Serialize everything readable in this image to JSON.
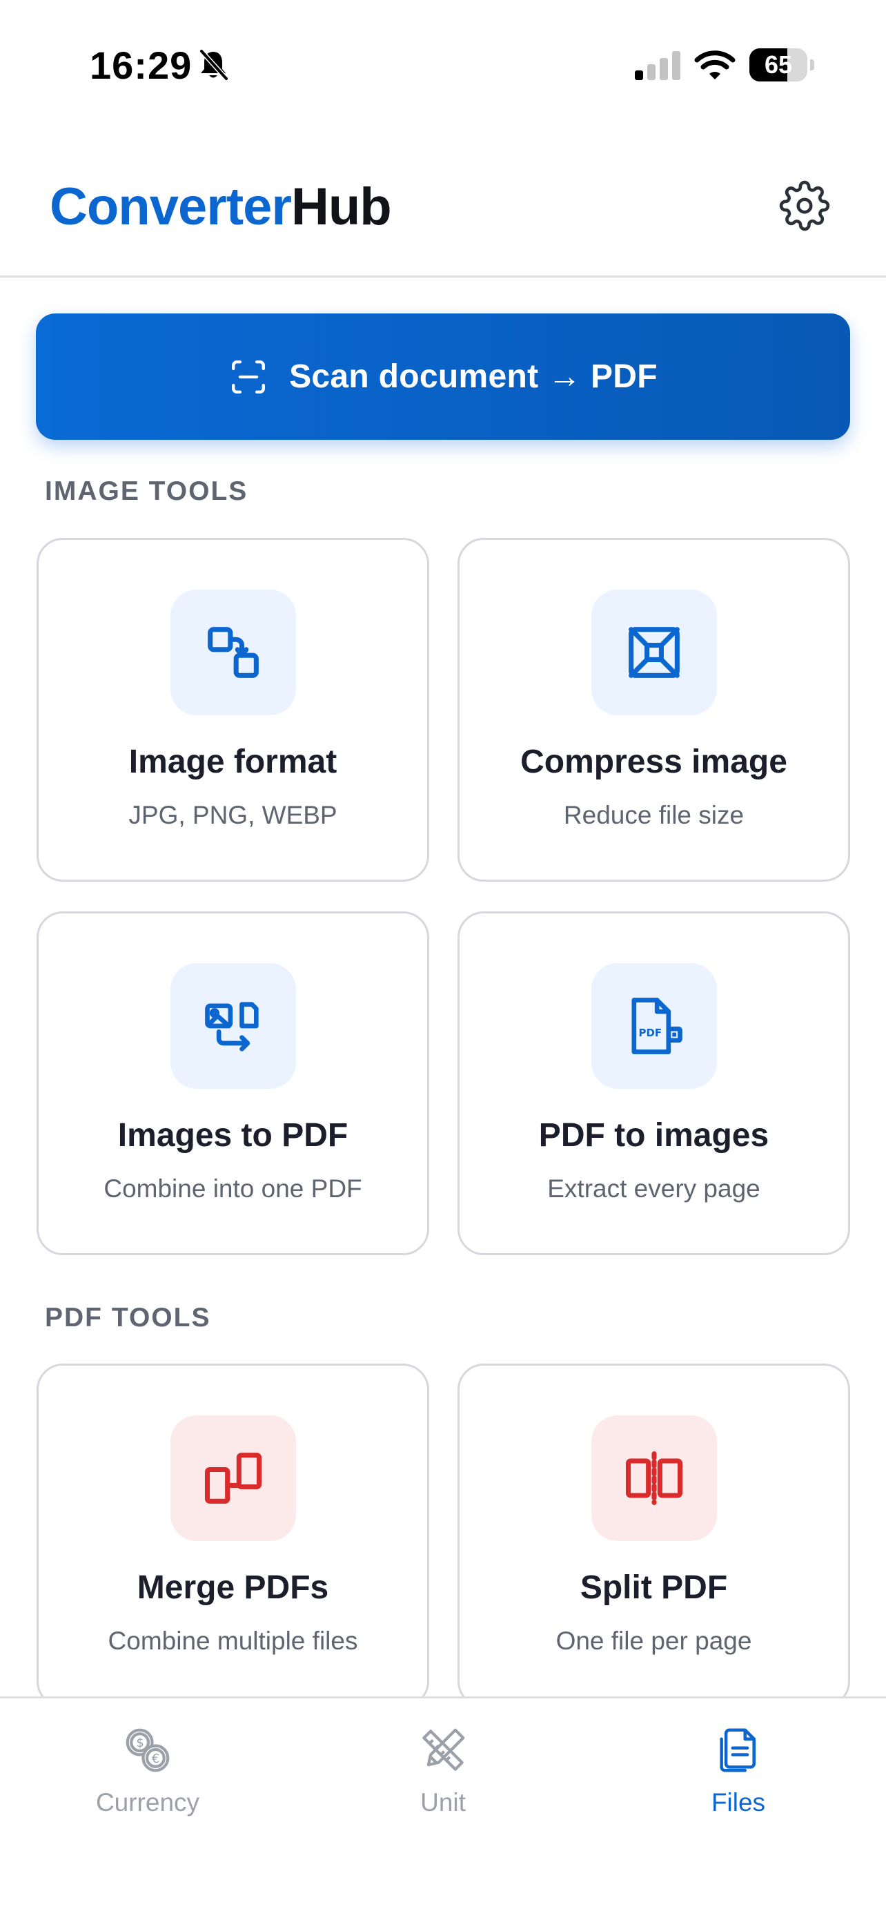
{
  "status_bar": {
    "time": "16:29",
    "battery": "65",
    "battery_level": 0.65,
    "icons": [
      "bell-slash-icon",
      "cellular-signal-icon",
      "wifi-icon",
      "battery-icon"
    ]
  },
  "header": {
    "logo_part_1": "Converter",
    "logo_part_2": "Hub",
    "settings_icon": "gear-icon"
  },
  "scan": {
    "label": "Scan document → PDF",
    "icon": "scan-frame-icon"
  },
  "sections": {
    "image_tools": "IMAGE TOOLS",
    "pdf_tools": "PDF TOOLS"
  },
  "image_tools": [
    {
      "title": "Image format",
      "subtitle": "JPG, PNG, WEBP",
      "icon": "format-convert-icon"
    },
    {
      "title": "Compress image",
      "subtitle": "Reduce file size",
      "icon": "compress-icon"
    },
    {
      "title": "Images to PDF",
      "subtitle": "Combine into one PDF",
      "icon": "images-to-pdf-icon"
    },
    {
      "title": "PDF to images",
      "subtitle": "Extract every page",
      "icon": "pdf-to-images-icon"
    }
  ],
  "pdf_tools": [
    {
      "title": "Merge PDFs",
      "subtitle": "Combine multiple files",
      "icon": "merge-icon"
    },
    {
      "title": "Split PDF",
      "subtitle": "One file per page",
      "icon": "split-icon"
    }
  ],
  "tabs": [
    {
      "label": "Currency",
      "icon": "currency-coins-icon",
      "active": false
    },
    {
      "label": "Unit",
      "icon": "ruler-pencil-icon",
      "active": false
    },
    {
      "label": "Files",
      "icon": "files-icon",
      "active": true
    }
  ],
  "colors": {
    "accent": "#0b66d0",
    "pdf_accent": "#d92b2b",
    "icon_tile_blue": "#eaf3ff",
    "icon_tile_red": "#fce9e9",
    "inactive_tab": "#9ba0a9"
  }
}
